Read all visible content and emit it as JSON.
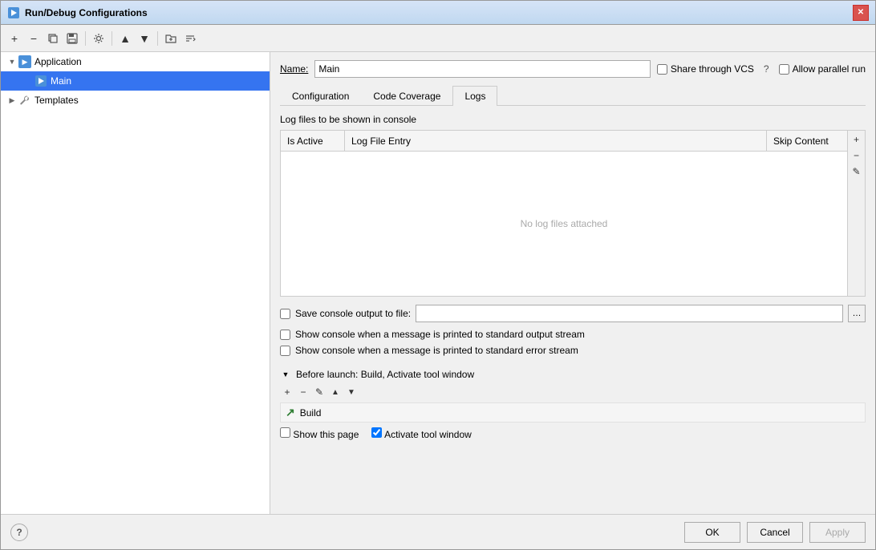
{
  "titleBar": {
    "title": "Run/Debug Configurations",
    "closeLabel": "✕"
  },
  "toolbar": {
    "addLabel": "+",
    "removeLabel": "−",
    "copyLabel": "⧉",
    "saveLabel": "💾",
    "settingsLabel": "⚙",
    "upLabel": "▲",
    "downLabel": "▼",
    "folderLabel": "📁",
    "sortLabel": "⇅"
  },
  "tree": {
    "items": [
      {
        "id": "application",
        "label": "Application",
        "indent": 0,
        "expanded": true,
        "hasChildren": true,
        "iconType": "app",
        "selected": false
      },
      {
        "id": "main",
        "label": "Main",
        "indent": 1,
        "expanded": false,
        "hasChildren": false,
        "iconType": "run",
        "selected": true
      },
      {
        "id": "templates",
        "label": "Templates",
        "indent": 0,
        "expanded": false,
        "hasChildren": true,
        "iconType": "wrench",
        "selected": false
      }
    ]
  },
  "nameField": {
    "label": "Name:",
    "value": "Main"
  },
  "shareOptions": {
    "shareVcsLabel": "Share through VCS",
    "helpIcon": "?",
    "parallelLabel": "Allow parallel run"
  },
  "tabs": [
    {
      "id": "configuration",
      "label": "Configuration",
      "active": false
    },
    {
      "id": "codeCoverage",
      "label": "Code Coverage",
      "active": false
    },
    {
      "id": "logs",
      "label": "Logs",
      "active": true
    }
  ],
  "logsSection": {
    "headerLabel": "Log files to be shown in console",
    "tableColumns": {
      "isActive": "Is Active",
      "logFileEntry": "Log File Entry",
      "skipContent": "Skip Content"
    },
    "emptyMessage": "No log files attached",
    "addBtn": "+",
    "removeBtn": "−",
    "editBtn": "✎",
    "saveConsoleLabel": "Save console output to file:",
    "saveConsolePlaceholder": "",
    "browseIcon": "…",
    "checkboxes": [
      {
        "id": "showOutput",
        "label": "Show console when a message is printed to standard output stream",
        "checked": false
      },
      {
        "id": "showError",
        "label": "Show console when a message is printed to standard error stream",
        "checked": false
      }
    ]
  },
  "beforeLaunch": {
    "collapseIcon": "▼",
    "label": "Before launch: Build, Activate tool window",
    "toolbarBtns": [
      "+",
      "−",
      "✎",
      "▲",
      "▼"
    ],
    "items": [
      {
        "id": "build",
        "icon": "↗",
        "label": "Build"
      }
    ],
    "bottomOptions": [
      {
        "id": "showPage",
        "label": "Show this page",
        "checked": false
      },
      {
        "id": "activateTool",
        "label": "Activate tool window",
        "checked": true
      }
    ]
  },
  "footer": {
    "helpIcon": "?",
    "okLabel": "OK",
    "cancelLabel": "Cancel",
    "applyLabel": "Apply"
  }
}
